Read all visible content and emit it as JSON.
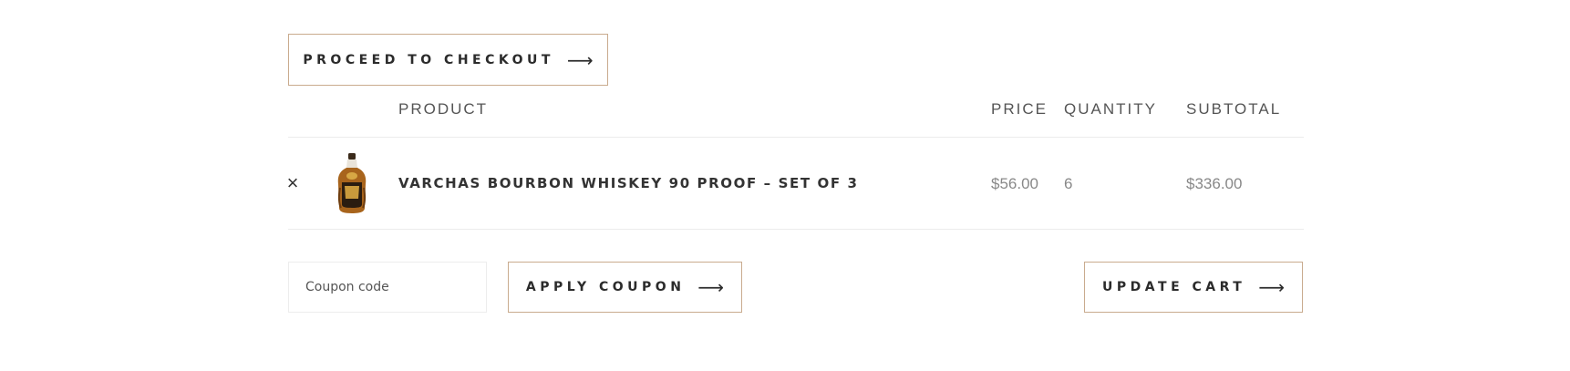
{
  "cart": {
    "checkout_label": "PROCEED TO CHECKOUT",
    "arrow_glyph": "⟶",
    "columns": {
      "product": "PRODUCT",
      "price": "PRICE",
      "quantity": "QUANTITY",
      "subtotal": "SUBTOTAL"
    },
    "items": [
      {
        "remove_glyph": "×",
        "name": "VARCHAS BOURBON WHISKEY 90 PROOF – SET OF 3",
        "price": "$56.00",
        "quantity": "6",
        "subtotal": "$336.00"
      }
    ],
    "coupon": {
      "placeholder": "Coupon code",
      "apply_label": "APPLY COUPON"
    },
    "update_label": "UPDATE CART"
  },
  "colors": {
    "button_border": "#c9ab8e",
    "divider": "#ececec",
    "text_dark": "#333333",
    "text_muted": "#888888"
  }
}
